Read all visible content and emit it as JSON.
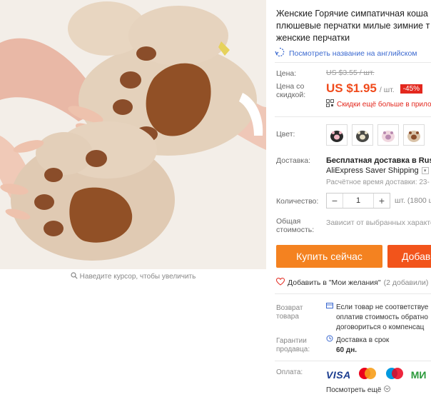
{
  "product": {
    "title_lines": [
      "Женские Горячие симпатичная коша",
      "плюшевые перчатки милые зимние т",
      "женские перчатки"
    ],
    "translate_link": "Посмотреть название на английском"
  },
  "gallery": {
    "zoom_hint": "Наведите курсор, чтобы увеличить"
  },
  "price": {
    "label": "Цена:",
    "old_price": "US $3.55 / шт.",
    "discount_label_line1": "Цена со",
    "discount_label_line2": "скидкой:",
    "new_price": "US $1.95",
    "unit": "/ шт.",
    "discount_badge": "-45%",
    "more_discounts": "Скидки ещё больше в прило"
  },
  "colors": {
    "label": "Цвет:",
    "swatch_count_note": "4"
  },
  "shipping": {
    "label": "Доставка:",
    "line1": "Бесплатная доставка в Russia",
    "line2": "AliExpress Saver Shipping",
    "line3": "Расчётное время доставки: 23-"
  },
  "quantity": {
    "label": "Количество:",
    "value": "1",
    "minus": "−",
    "plus": "+",
    "available": "шт. (1800 шт"
  },
  "total": {
    "label_line1": "Общая",
    "label_line2": "стоимость:",
    "value": "Зависит от выбранных характе"
  },
  "actions": {
    "buy_now": "Купить сейчас",
    "add_to_cart": "Добав"
  },
  "wishlist": {
    "label": "Добавить в \"Мои желания\"",
    "count": "(2 добавили)"
  },
  "guarantees": {
    "return_label_line1": "Возврат",
    "return_label_line2": "товара",
    "return_line1": "Если товар не соответствуе",
    "return_line2": "оплатив стоимость обратно",
    "return_line3": "договориться о компенсац",
    "seller_label_line1": "Гарантии",
    "seller_label_line2": "продавца:",
    "seller_line1": "Доставка в срок",
    "seller_line2": "60 дн."
  },
  "payment": {
    "label": "Оплата:",
    "visa": "VISA",
    "mir": "МИ",
    "more": "Посмотреть ещё"
  },
  "theme": {
    "accent_orange": "#f48220",
    "cart_orange": "#f2541b",
    "price_red": "#f04b1c",
    "link_blue": "#3c6ad0"
  }
}
